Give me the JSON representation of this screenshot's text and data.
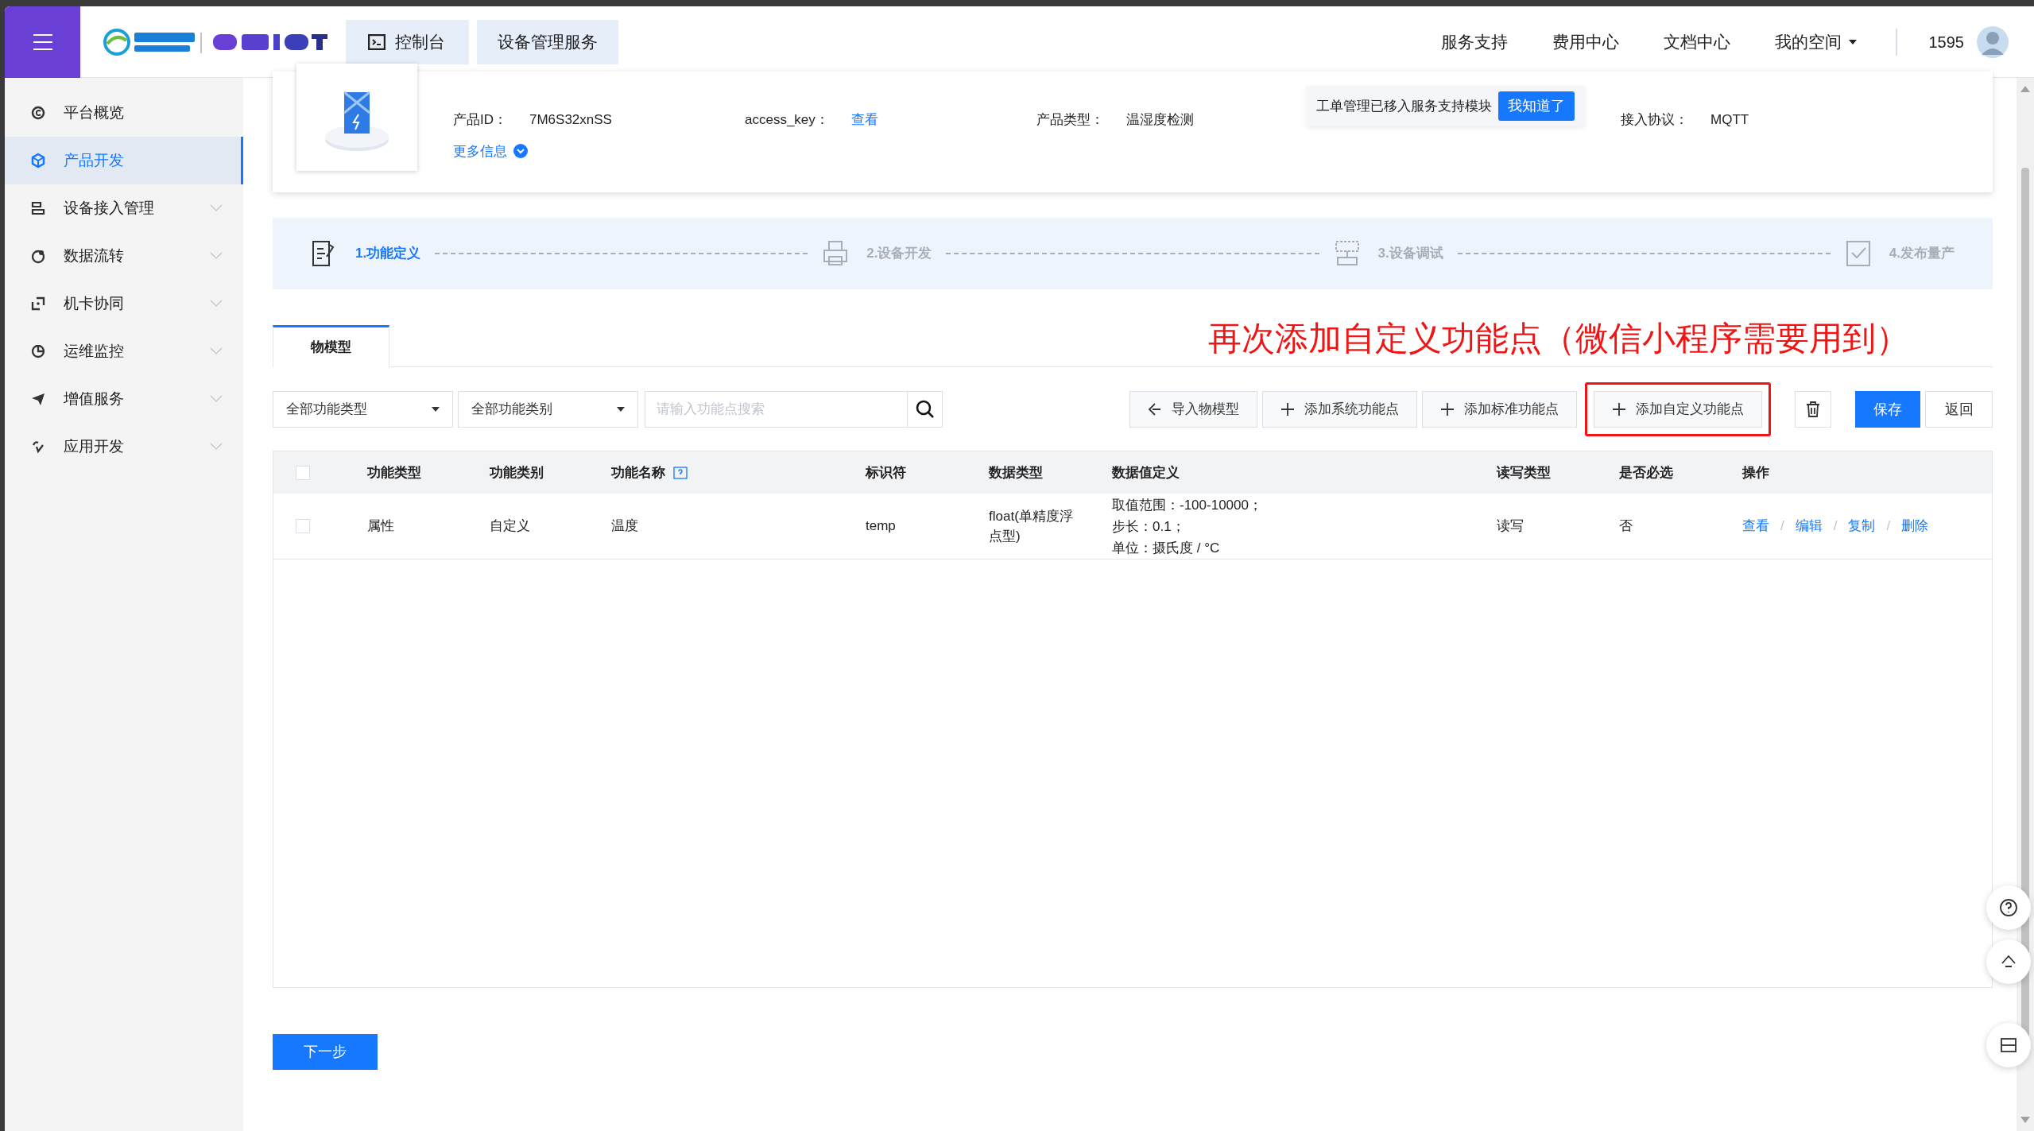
{
  "header": {
    "home": "控制台",
    "breadcrumb": "设备管理服务",
    "nav": [
      {
        "label": "服务支持",
        "dropdown": false
      },
      {
        "label": "费用中心",
        "dropdown": false
      },
      {
        "label": "文档中心",
        "dropdown": false
      },
      {
        "label": "我的空间",
        "dropdown": true
      }
    ],
    "user": "1595"
  },
  "sidebar": {
    "items": [
      {
        "label": "平台概览",
        "selected": false,
        "expandable": false
      },
      {
        "label": "产品开发",
        "selected": true,
        "expandable": false
      },
      {
        "label": "设备接入管理",
        "selected": false,
        "expandable": true
      },
      {
        "label": "数据流转",
        "selected": false,
        "expandable": true
      },
      {
        "label": "机卡协同",
        "selected": false,
        "expandable": true
      },
      {
        "label": "运维监控",
        "selected": false,
        "expandable": true
      },
      {
        "label": "增值服务",
        "selected": false,
        "expandable": true
      },
      {
        "label": "应用开发",
        "selected": false,
        "expandable": true
      }
    ]
  },
  "product": {
    "fields": [
      {
        "label": "产品ID：",
        "value": "7M6S32xnSS",
        "kind": "text"
      },
      {
        "label": "access_key：",
        "value": "查看",
        "kind": "link"
      },
      {
        "label": "产品类型：",
        "value": "温湿度检测",
        "kind": "text"
      },
      {
        "label": "接入协议：",
        "value": "MQTT",
        "kind": "text"
      }
    ],
    "more": "更多信息"
  },
  "tooltip": {
    "text": "工单管理已移入服务支持模块",
    "button": "我知道了"
  },
  "steps": [
    {
      "label": "1.功能定义",
      "selected": true
    },
    {
      "label": "2.设备开发",
      "selected": false
    },
    {
      "label": "3.设备调试",
      "selected": false
    },
    {
      "label": "4.发布量产",
      "selected": false
    }
  ],
  "annotation": "再次添加自定义功能点（微信小程序需要用到）",
  "tabs": [
    {
      "label": "物模型",
      "selected": true
    }
  ],
  "toolbar": {
    "filters": [
      "全部功能类型",
      "全部功能类别"
    ],
    "search": {
      "placeholder": "请输入功能点搜索"
    },
    "buttons": [
      {
        "label": "导入物模型",
        "kind": "import",
        "highlighted": false
      },
      {
        "label": "添加系统功能点",
        "kind": "add",
        "highlighted": false
      },
      {
        "label": "添加标准功能点",
        "kind": "add",
        "highlighted": false
      },
      {
        "label": "添加自定义功能点",
        "kind": "add",
        "highlighted": true
      }
    ],
    "save": "保存",
    "back": "返回"
  },
  "table": {
    "select_all": {
      "checked": false
    },
    "separator": "/",
    "columns": [
      "功能类型",
      "功能类别",
      "功能名称",
      "标识符",
      "数据类型",
      "数据值定义",
      "读写类型",
      "是否必选",
      "操作"
    ],
    "rows": [
      {
        "checked": false,
        "cells": [
          "属性",
          "自定义",
          "温度",
          "temp",
          "float(单精度浮点型)"
        ],
        "definition": [
          "取值范围：-100-10000；",
          "步长：0.1；",
          "单位：摄氏度 / °C"
        ],
        "rw": "读写",
        "required": "否",
        "actions": [
          "查看",
          "编辑",
          "复制",
          "删除"
        ]
      }
    ]
  },
  "next": "下一步"
}
